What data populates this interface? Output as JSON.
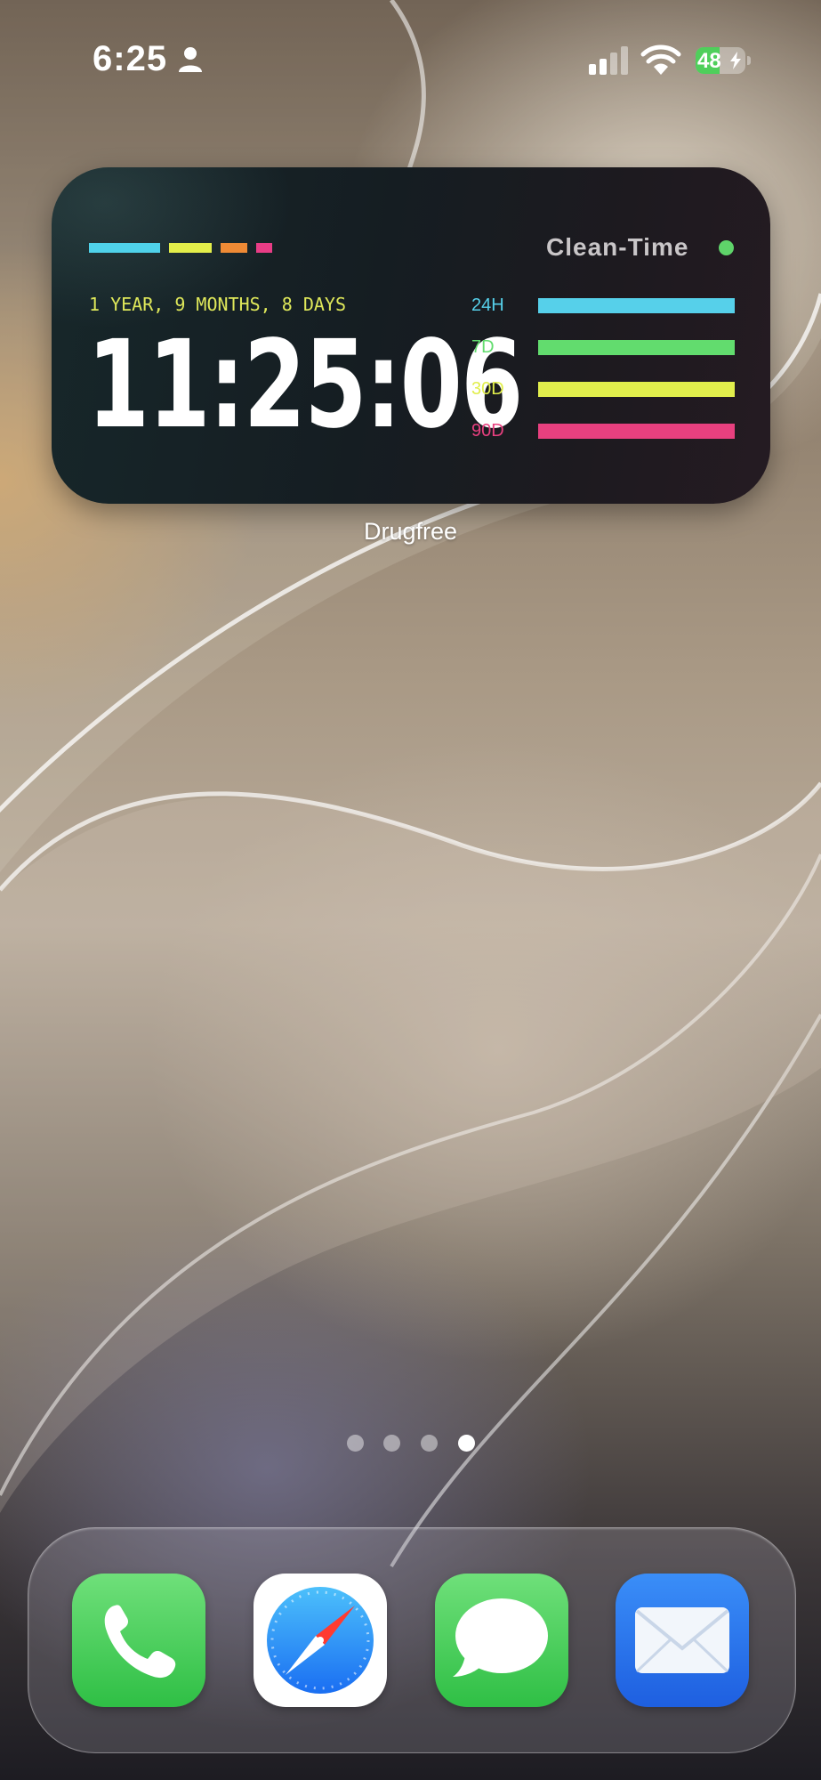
{
  "status_bar": {
    "time": "6:25",
    "person_icon": "person-icon",
    "signal_icon": "cellular-signal-icon",
    "wifi_icon": "wifi-icon",
    "battery_percent": "48",
    "battery_level": 0.48,
    "battery_charging": true,
    "battery_color": "#4fcf5b"
  },
  "widget": {
    "title": "Clean-Time",
    "status_dot_color": "#5fd46a",
    "accent_colors": [
      "#4fd2ea",
      "#e3ee4a",
      "#ee8a35",
      "#e83d86"
    ],
    "duration": "1 YEAR, 9 MONTHS, 8 DAYS",
    "duration_color": "#dfe85a",
    "clock": "11:25:06",
    "periods": [
      {
        "label": "24H",
        "color": "#56d0ea",
        "progress": 1.0
      },
      {
        "label": "7D",
        "color": "#62dc6e",
        "progress": 1.0
      },
      {
        "label": "30D",
        "color": "#e1ee4c",
        "progress": 1.0
      },
      {
        "label": "90D",
        "color": "#e8407f",
        "progress": 1.0
      }
    ]
  },
  "app_label": "Drugfree",
  "page_indicator": {
    "count": 4,
    "current": 4
  },
  "dock": {
    "apps": [
      {
        "name": "Phone",
        "icon": "phone-icon"
      },
      {
        "name": "Safari",
        "icon": "safari-compass-icon"
      },
      {
        "name": "Messages",
        "icon": "messages-bubble-icon"
      },
      {
        "name": "Mail",
        "icon": "mail-envelope-icon"
      }
    ]
  }
}
